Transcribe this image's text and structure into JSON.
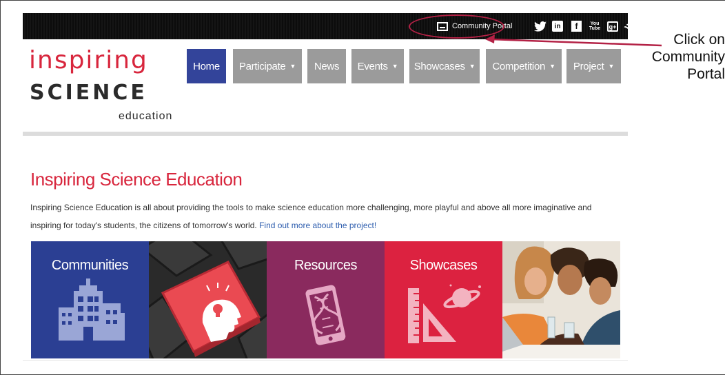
{
  "topbar": {
    "community_portal_label": "Community Portal",
    "social_icons": [
      "twitter-icon",
      "linkedin-icon",
      "facebook-icon",
      "youtube-icon",
      "googleplus-icon",
      "rss-icon"
    ],
    "social_glyphs": {
      "linkedin": "in",
      "facebook": "f",
      "youtube_top": "You",
      "youtube_bottom": "Tube",
      "googleplus": "g+",
      "rss": ")))"
    }
  },
  "annotation": {
    "text": "Click on\nCommunity\nPortal",
    "color": "#b32145"
  },
  "logo": {
    "line1": "inspiring",
    "line2": "SCIENCE",
    "line3": "education"
  },
  "nav": {
    "items": [
      {
        "label": "Home",
        "dropdown": false,
        "active": true
      },
      {
        "label": "Participate",
        "dropdown": true
      },
      {
        "label": "News",
        "dropdown": false
      },
      {
        "label": "Events",
        "dropdown": true
      },
      {
        "label": "Showcases",
        "dropdown": true
      },
      {
        "label": "Competition",
        "dropdown": true
      },
      {
        "label": "Project",
        "dropdown": true
      }
    ],
    "caret": "▼"
  },
  "main": {
    "heading": "Inspiring Science Education",
    "intro_text": "Inspiring Science Education is all about providing the tools to make science education more challenging, more playful and above all more imaginative and inspiring for today's students, the citizens of tomorrow's world.",
    "intro_link": "Find out more about the project!",
    "tiles": [
      {
        "title": "Communities"
      },
      {
        "title": ""
      },
      {
        "title": "Resources"
      },
      {
        "title": "Showcases"
      },
      {
        "title": ""
      }
    ]
  },
  "colors": {
    "brand_red": "#d8263d",
    "nav_active": "#33449a",
    "nav_inactive": "#9b9b9b",
    "communities": "#2b3f93",
    "resources": "#8a2a5e",
    "showcases": "#dc2240"
  }
}
